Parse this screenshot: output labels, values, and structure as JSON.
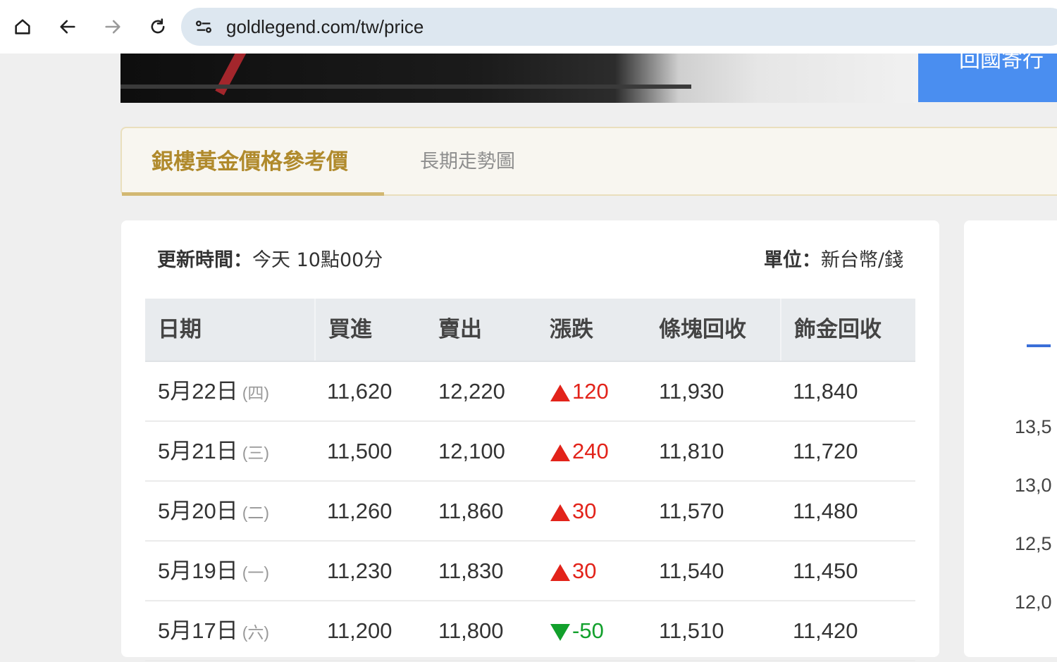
{
  "browser": {
    "url": "goldlegend.com/tw/price",
    "icons": [
      "home-icon",
      "back-icon",
      "forward-icon",
      "reload-icon",
      "site-settings-icon"
    ]
  },
  "banner": {
    "right_text": "回國寄行"
  },
  "tabs": [
    {
      "label": "銀樓黃金價格參考價",
      "active": true
    },
    {
      "label": "長期走勢圖",
      "active": false
    }
  ],
  "card": {
    "update_label": "更新時間：",
    "update_value": "今天 10點00分",
    "unit_label": "單位：",
    "unit_value": "新台幣/錢"
  },
  "table": {
    "headers": [
      "日期",
      "買進",
      "賣出",
      "漲跌",
      "條塊回收",
      "飾金回收"
    ],
    "rows": [
      {
        "date": "5月22日",
        "weekday": "(四)",
        "buy": "11,620",
        "sell": "12,220",
        "change": "120",
        "dir": "up",
        "bar": "11,930",
        "jewelry": "11,840"
      },
      {
        "date": "5月21日",
        "weekday": "(三)",
        "buy": "11,500",
        "sell": "12,100",
        "change": "240",
        "dir": "up",
        "bar": "11,810",
        "jewelry": "11,720"
      },
      {
        "date": "5月20日",
        "weekday": "(二)",
        "buy": "11,260",
        "sell": "11,860",
        "change": "30",
        "dir": "up",
        "bar": "11,570",
        "jewelry": "11,480"
      },
      {
        "date": "5月19日",
        "weekday": "(一)",
        "buy": "11,230",
        "sell": "11,830",
        "change": "30",
        "dir": "up",
        "bar": "11,540",
        "jewelry": "11,450"
      },
      {
        "date": "5月17日",
        "weekday": "(六)",
        "buy": "11,200",
        "sell": "11,800",
        "change": "-50",
        "dir": "down",
        "bar": "11,510",
        "jewelry": "11,420"
      }
    ]
  },
  "colors": {
    "up": "#e2231a",
    "down": "#12a02c",
    "accent_gold": "#b08a2c"
  },
  "side_chart": {
    "y_ticks": [
      "13,5",
      "13,0",
      "12,5",
      "12,0"
    ]
  }
}
